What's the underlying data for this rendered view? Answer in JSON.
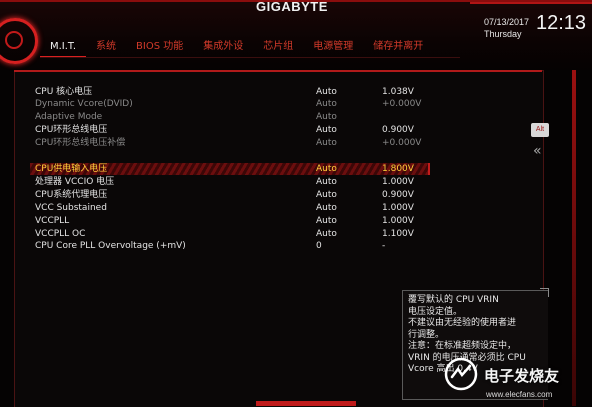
{
  "brand": "GIGABYTE",
  "date": "07/13/2017",
  "weekday": "Thursday",
  "time": "12:13",
  "tabs": [
    {
      "label": "M.I.T.",
      "active": true
    },
    {
      "label": "系统"
    },
    {
      "label": "BIOS 功能"
    },
    {
      "label": "集成外设"
    },
    {
      "label": "芯片组"
    },
    {
      "label": "电源管理"
    },
    {
      "label": "储存并离开"
    }
  ],
  "settings": [
    {
      "label": "CPU 核心电压",
      "mode": "Auto",
      "value": "1.038V",
      "style": "bright"
    },
    {
      "label": "Dynamic Vcore(DVID)",
      "mode": "Auto",
      "value": "+0.000V",
      "style": "dim"
    },
    {
      "label": "Adaptive Mode",
      "mode": "Auto",
      "value": "",
      "style": "dim"
    },
    {
      "label": "CPU环形总线电压",
      "mode": "Auto",
      "value": "0.900V",
      "style": "bright"
    },
    {
      "label": "CPU环形总线电压补偿",
      "mode": "Auto",
      "value": "+0.000V",
      "style": "dim"
    },
    {
      "label": "CPU供电输入电压",
      "mode": "Auto",
      "value": "1.800V",
      "style": "sel"
    },
    {
      "label": "处理器 VCCIO 电压",
      "mode": "Auto",
      "value": "1.000V",
      "style": "bright"
    },
    {
      "label": "CPU系统代理电压",
      "mode": "Auto",
      "value": "0.900V",
      "style": "bright"
    },
    {
      "label": "VCC Substained",
      "mode": "Auto",
      "value": "1.000V",
      "style": "bright"
    },
    {
      "label": "VCCPLL",
      "mode": "Auto",
      "value": "1.000V",
      "style": "bright"
    },
    {
      "label": "VCCPLL OC",
      "mode": "Auto",
      "value": "1.100V",
      "style": "bright"
    },
    {
      "label": "CPU Core PLL Overvoltage (+mV)",
      "mode": "0",
      "value": "-",
      "style": "bright"
    }
  ],
  "alt_button": "Alt",
  "help_lines": [
    "覆写默认的 CPU VRIN",
    "电压设定值。",
    "不建议由无经验的使用者进",
    "行调整。",
    "注意：在标准超频设定中，",
    "VRIN 的电压通常必须比 CPU",
    "Vcore 高出 0.4V"
  ],
  "watermark": {
    "text": "电子发烧友",
    "url": "www.elecfans.com"
  }
}
